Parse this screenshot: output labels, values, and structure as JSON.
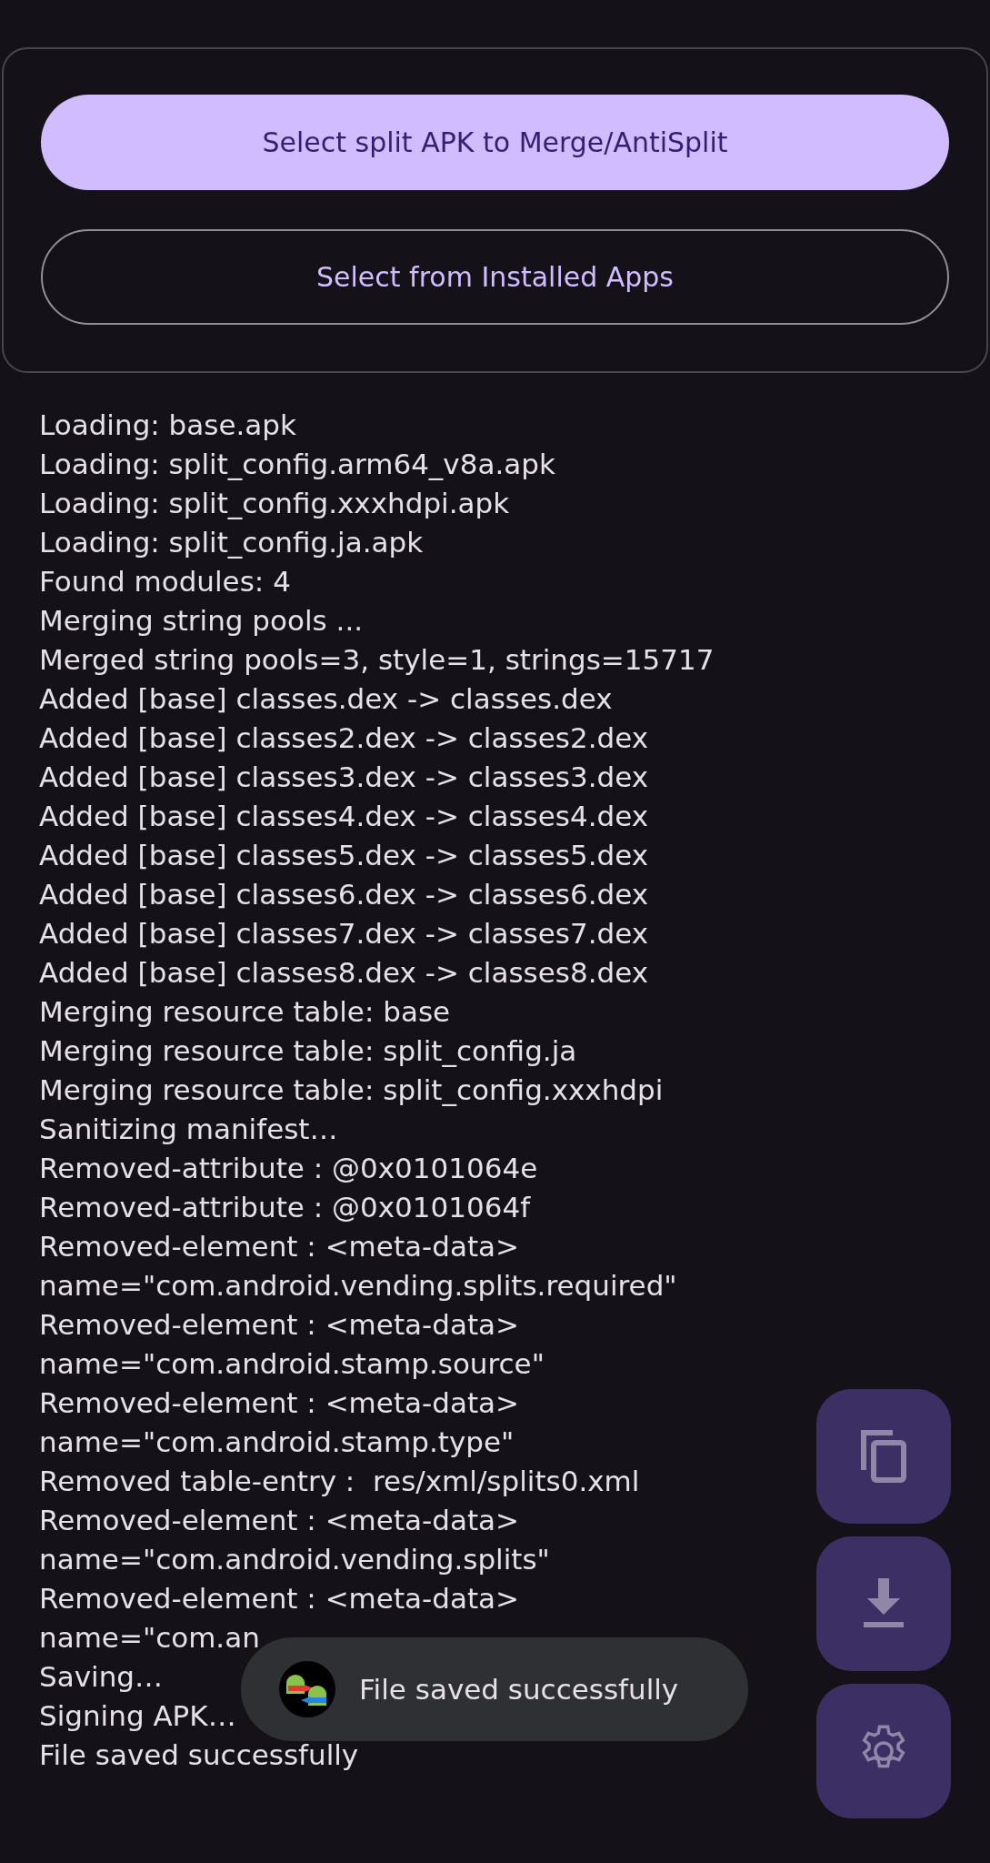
{
  "buttons": [
    {
      "label": "Select split APK to Merge/AntiSplit",
      "kind": "filled"
    },
    {
      "label": "Select from Installed Apps",
      "kind": "outlined"
    }
  ],
  "log": [
    "Loading: base.apk",
    "Loading: split_config.arm64_v8a.apk",
    "Loading: split_config.xxxhdpi.apk",
    "Loading: split_config.ja.apk",
    "Found modules: 4",
    "Merging string pools ...",
    "Merged string pools=3, style=1, strings=15717",
    "Added [base] classes.dex -> classes.dex",
    "Added [base] classes2.dex -> classes2.dex",
    "Added [base] classes3.dex -> classes3.dex",
    "Added [base] classes4.dex -> classes4.dex",
    "Added [base] classes5.dex -> classes5.dex",
    "Added [base] classes6.dex -> classes6.dex",
    "Added [base] classes7.dex -> classes7.dex",
    "Added [base] classes8.dex -> classes8.dex",
    "Merging resource table: base",
    "Merging resource table: split_config.ja",
    "Merging resource table: split_config.xxxhdpi",
    "Sanitizing manifest…",
    "Removed-attribute : @0x0101064e",
    "Removed-attribute : @0x0101064f",
    "Removed-element : <meta-data>",
    "name=\"com.android.vending.splits.required\"",
    "Removed-element : <meta-data>",
    "name=\"com.android.stamp.source\"",
    "Removed-element : <meta-data>",
    "name=\"com.android.stamp.type\"",
    "Removed table-entry :  res/xml/splits0.xml",
    "Removed-element : <meta-data>",
    "name=\"com.android.vending.splits\"",
    "Removed-element : <meta-data>",
    "name=\"com.an",
    "Saving…",
    "Signing APK…",
    "File saved successfully"
  ],
  "fabs": [
    {
      "kind": "copy"
    },
    {
      "kind": "download"
    },
    {
      "kind": "settings"
    }
  ],
  "toast": {
    "text": "File saved successfully"
  }
}
